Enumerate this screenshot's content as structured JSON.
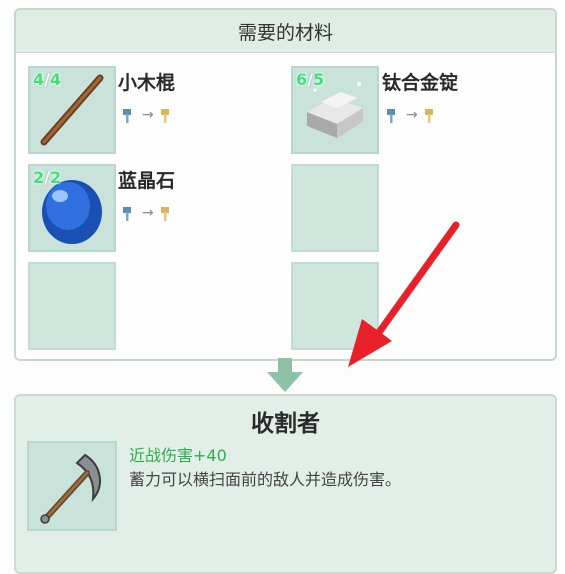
{
  "materials": {
    "title": "需要的材料",
    "items": [
      {
        "name": "小木棍",
        "count": "4",
        "total": "4",
        "icon": "stick-icon"
      },
      {
        "name": "钛合金锭",
        "count": "6",
        "total": "5",
        "icon": "titanium-ingot-icon"
      },
      {
        "name": "蓝晶石",
        "count": "2",
        "total": "2",
        "icon": "blue-crystal-icon"
      }
    ],
    "transform_arrow": "→"
  },
  "recipe": {
    "title": "收割者",
    "stat": "近战伤害+40",
    "description": "蓄力可以横扫面前的敌人并造成伤害。",
    "icon": "pickaxe-icon"
  },
  "colors": {
    "panel_header": "#deeee5",
    "slot": "#c9e3da",
    "count_green": "#3ee07a",
    "stat_green": "#2fae4a",
    "annotation_red": "#e8202a"
  }
}
